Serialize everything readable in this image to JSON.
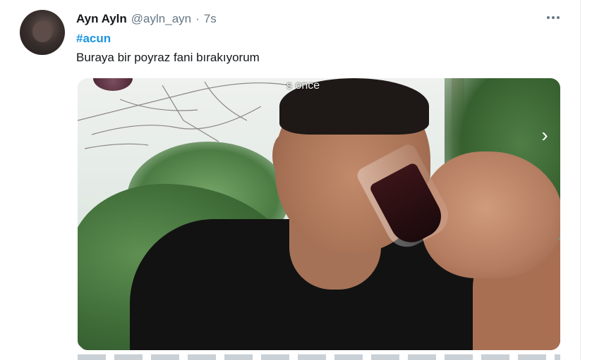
{
  "tweet": {
    "display_name": "Ayn Ayln",
    "handle": "@ayln_ayn",
    "separator": "·",
    "time": "7s",
    "hashtag": "#acun",
    "text": "Buraya bir poyraz fani bırakıyorum",
    "more_icon": "more-horizontal-icon"
  },
  "media": {
    "overlay_text": "s once",
    "next_icon": "chevron-right-icon",
    "next_glyph": "›"
  },
  "colors": {
    "link": "#1b95e0",
    "secondary_text": "#657786",
    "primary_text": "#14171a",
    "divider": "#e6ecf0"
  }
}
